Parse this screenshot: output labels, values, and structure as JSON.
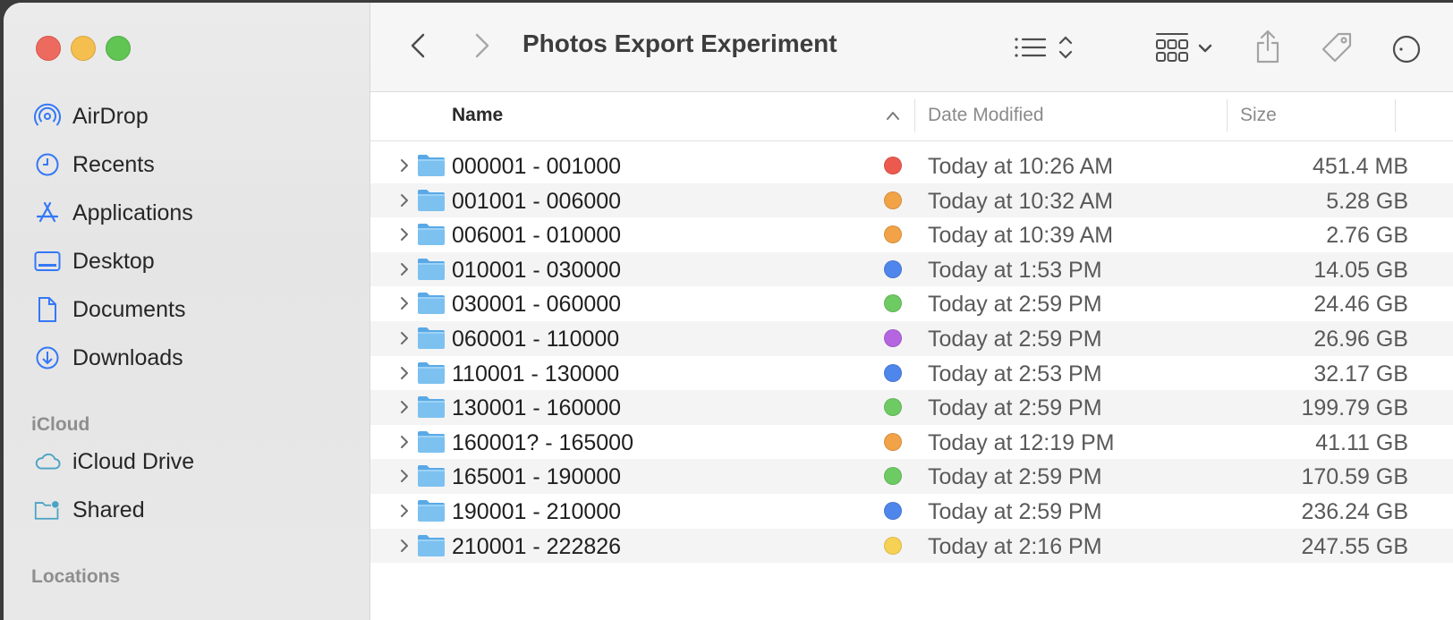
{
  "window": {
    "title": "Photos Export Experiment"
  },
  "sidebar": {
    "favorites": [
      {
        "label": "AirDrop",
        "icon": "airdrop-icon"
      },
      {
        "label": "Recents",
        "icon": "clock-icon"
      },
      {
        "label": "Applications",
        "icon": "applications-icon"
      },
      {
        "label": "Desktop",
        "icon": "desktop-icon"
      },
      {
        "label": "Documents",
        "icon": "document-icon"
      },
      {
        "label": "Downloads",
        "icon": "download-icon"
      }
    ],
    "icloud_heading": "iCloud",
    "icloud": [
      {
        "label": "iCloud Drive",
        "icon": "cloud-icon"
      },
      {
        "label": "Shared",
        "icon": "shared-folder-icon"
      }
    ],
    "locations_heading": "Locations",
    "accent_color": "#3478f6"
  },
  "columns": {
    "name": "Name",
    "date": "Date Modified",
    "size": "Size"
  },
  "rows": [
    {
      "name": "000001 - 001000",
      "tag": "#ec5a4f",
      "date": "Today at 10:26 AM",
      "size": "451.4 MB"
    },
    {
      "name": "001001 - 006000",
      "tag": "#f2a247",
      "date": "Today at 10:32 AM",
      "size": "5.28 GB"
    },
    {
      "name": "006001 - 010000",
      "tag": "#f2a247",
      "date": "Today at 10:39 AM",
      "size": "2.76 GB"
    },
    {
      "name": "010001 - 030000",
      "tag": "#4f86ec",
      "date": "Today at 1:53 PM",
      "size": "14.05 GB"
    },
    {
      "name": "030001 - 060000",
      "tag": "#6ecb63",
      "date": "Today at 2:59 PM",
      "size": "24.46 GB"
    },
    {
      "name": "060001 - 110000",
      "tag": "#b565e0",
      "date": "Today at 2:59 PM",
      "size": "26.96 GB"
    },
    {
      "name": "110001 - 130000",
      "tag": "#4f86ec",
      "date": "Today at 2:53 PM",
      "size": "32.17 GB"
    },
    {
      "name": "130001 - 160000",
      "tag": "#6ecb63",
      "date": "Today at 2:59 PM",
      "size": "199.79 GB"
    },
    {
      "name": "160001? - 165000",
      "tag": "#f2a247",
      "date": "Today at 12:19 PM",
      "size": "41.11 GB"
    },
    {
      "name": "165001 - 190000",
      "tag": "#6ecb63",
      "date": "Today at 2:59 PM",
      "size": "170.59 GB"
    },
    {
      "name": "190001 - 210000",
      "tag": "#4f86ec",
      "date": "Today at 2:59 PM",
      "size": "236.24 GB"
    },
    {
      "name": "210001 - 222826",
      "tag": "#f7d154",
      "date": "Today at 2:16 PM",
      "size": "247.55 GB"
    }
  ]
}
